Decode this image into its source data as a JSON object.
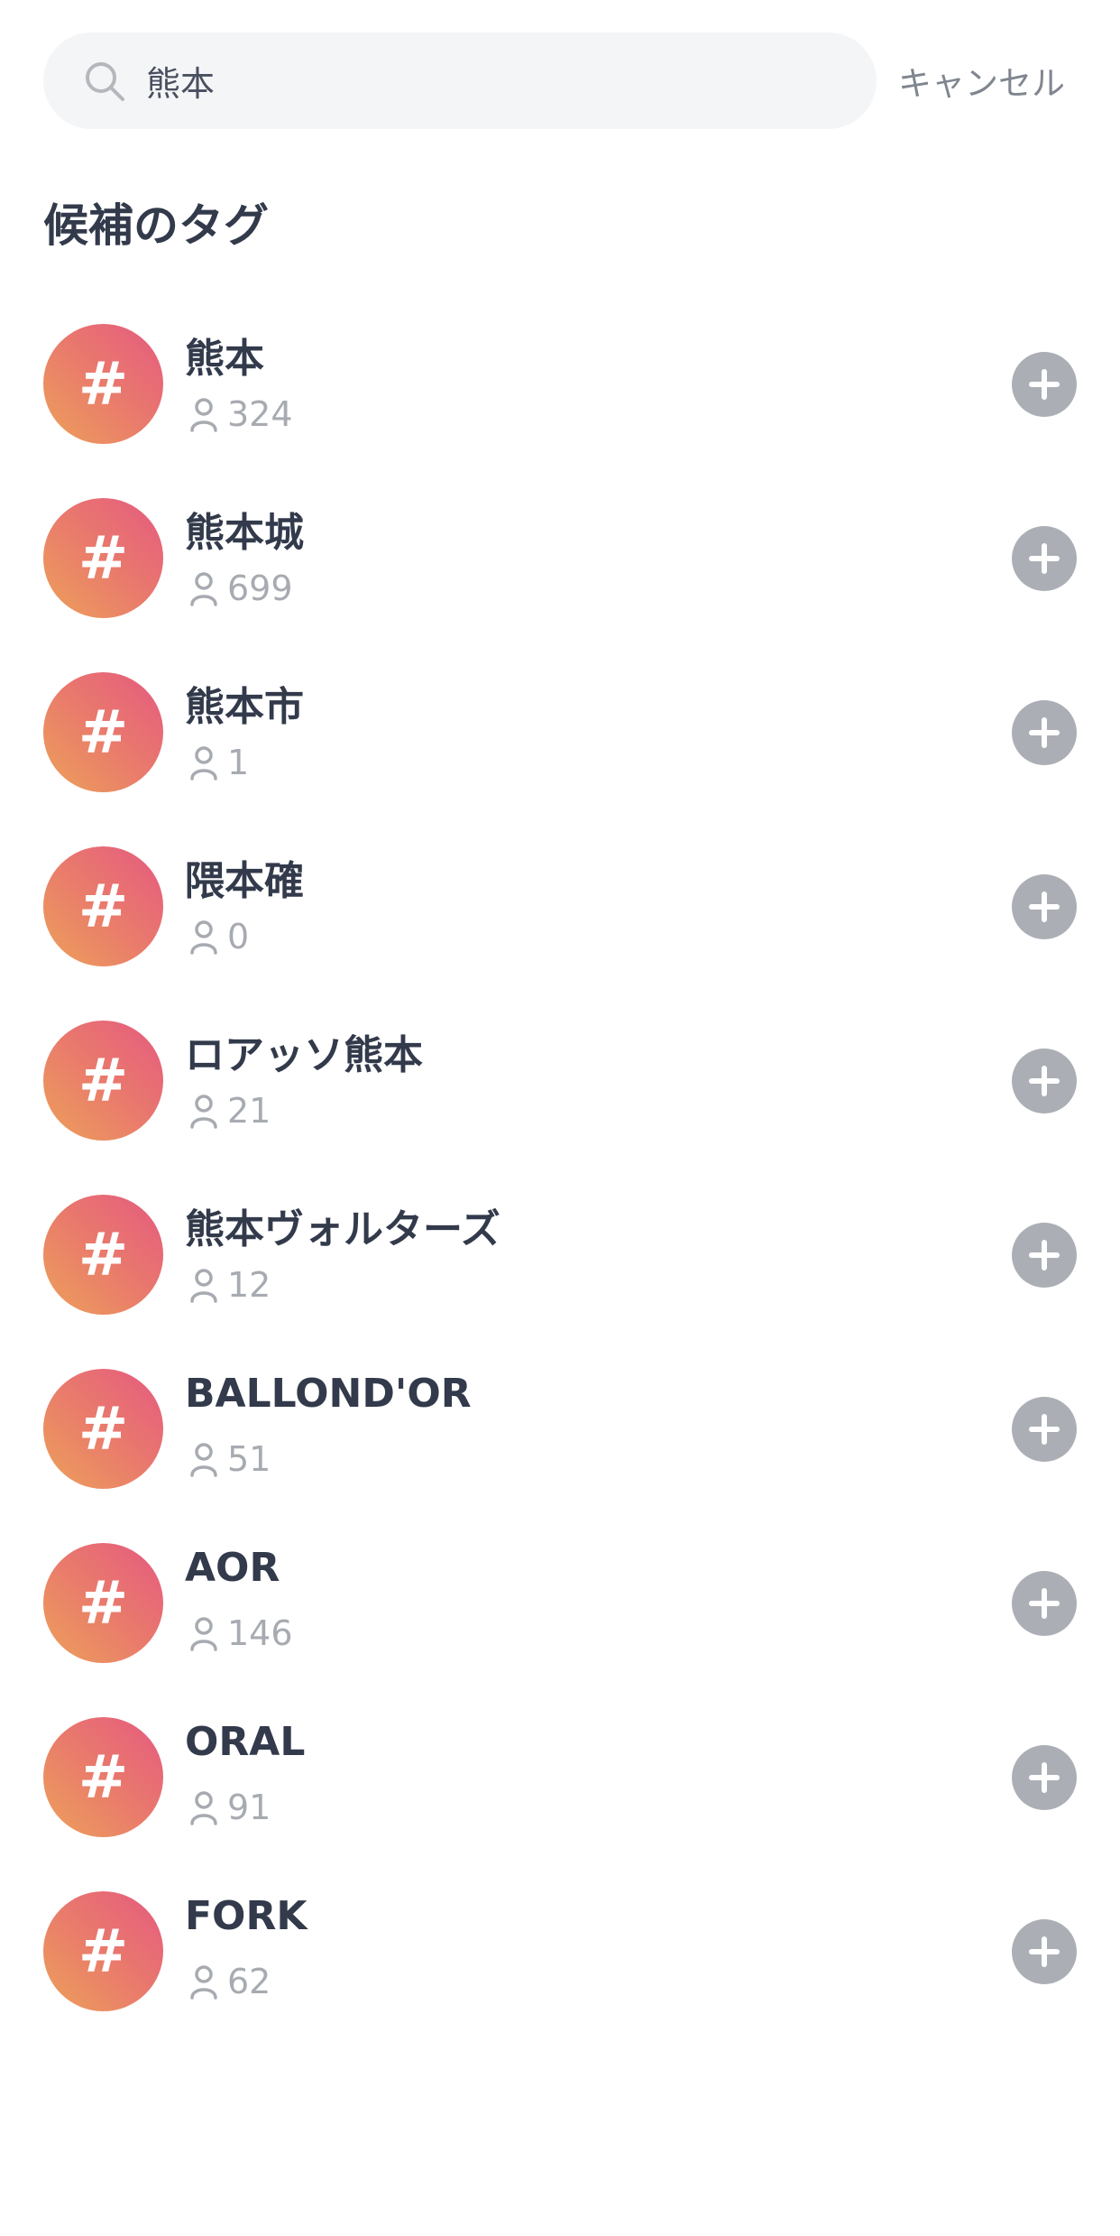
{
  "search": {
    "value": "熊本",
    "icon": "search-icon"
  },
  "cancel_label": "キャンセル",
  "section_title": "候補のタグ",
  "colors": {
    "avatar_gradient": [
      "#e55a80",
      "#eda15a"
    ],
    "add_button": "#abafb5",
    "text": "#323a4b",
    "muted": "#a7abb1"
  },
  "tags": [
    {
      "name": "熊本",
      "count": "324"
    },
    {
      "name": "熊本城",
      "count": "699"
    },
    {
      "name": "熊本市",
      "count": "1"
    },
    {
      "name": "隈本確",
      "count": "0"
    },
    {
      "name": "ロアッソ熊本",
      "count": "21"
    },
    {
      "name": "熊本ヴォルターズ",
      "count": "12"
    },
    {
      "name": "BALLOND'OR",
      "count": "51"
    },
    {
      "name": "AOR",
      "count": "146"
    },
    {
      "name": "ORAL",
      "count": "91"
    },
    {
      "name": "FORK",
      "count": "62"
    }
  ]
}
